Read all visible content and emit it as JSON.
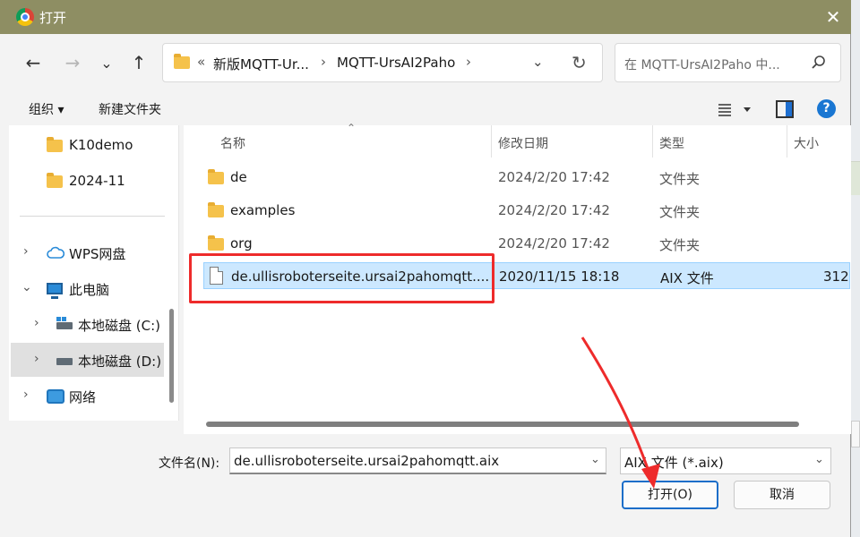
{
  "window": {
    "title": "打开",
    "close_glyph": "✕"
  },
  "nav": {
    "back": "←",
    "forward": "→",
    "recent": "⌄",
    "up": "↑"
  },
  "address": {
    "prefix": "«",
    "crumbs": [
      "新版MQTT-Ur...",
      "MQTT-UrsAI2Paho"
    ],
    "separator": "›",
    "dropdown": "⌄",
    "refresh": "↻"
  },
  "search": {
    "placeholder": "在 MQTT-UrsAI2Paho 中..."
  },
  "toolbar": {
    "organize": "组织 ▾",
    "new_folder": "新建文件夹",
    "help": "?"
  },
  "sidebar": {
    "items": [
      {
        "label": "K10demo",
        "icon": "folder-icon"
      },
      {
        "label": "2024-11",
        "icon": "folder-icon"
      },
      {
        "label": "WPS网盘",
        "icon": "cloud-icon",
        "chevron": "›"
      },
      {
        "label": "此电脑",
        "icon": "pc-icon",
        "chevron": "⌄"
      },
      {
        "label": "本地磁盘 (C:)",
        "icon": "drive-icon",
        "chevron": "›"
      },
      {
        "label": "本地磁盘 (D:)",
        "icon": "drive-icon",
        "chevron": "›",
        "selected": true
      },
      {
        "label": "网络",
        "icon": "network-icon",
        "chevron": "›"
      }
    ]
  },
  "columns": {
    "name": "名称",
    "date": "修改日期",
    "type": "类型",
    "size": "大小",
    "sort": "⌃"
  },
  "files": [
    {
      "name": "de",
      "date": "2024/2/20 17:42",
      "type": "文件夹",
      "size": ""
    },
    {
      "name": "examples",
      "date": "2024/2/20 17:42",
      "type": "文件夹",
      "size": ""
    },
    {
      "name": "org",
      "date": "2024/2/20 17:42",
      "type": "文件夹",
      "size": ""
    },
    {
      "name": "de.ullisroboterseite.ursai2pahomqtt....",
      "date": "2020/11/15 18:18",
      "type": "AIX 文件",
      "size": "312",
      "selected": true
    }
  ],
  "footer": {
    "filename_label": "文件名(N):",
    "filename_value": "de.ullisroboterseite.ursai2pahomqtt.aix",
    "filetype_value": "AIX 文件 (*.aix)",
    "chevron": "⌄",
    "open_button": "打开(O)",
    "cancel_button": "取消"
  },
  "colors": {
    "accent": "#1c6ec9",
    "selection": "#cce8ff",
    "annotation": "#ee2b2b",
    "titlebar": "#8e8e63"
  }
}
